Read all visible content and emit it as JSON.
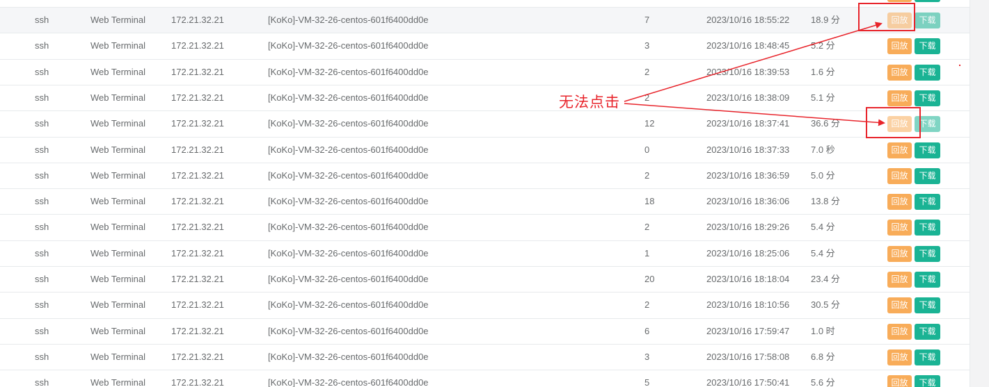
{
  "buttons": {
    "replay_label": "回放",
    "download_label": "下载"
  },
  "annotation": {
    "text": "无法点击",
    "color": "#e8242b"
  },
  "colors": {
    "replay": "#f8ac59",
    "download": "#1ab394",
    "text": "#676a6c",
    "border": "#e7eaec"
  },
  "sessions": [
    {
      "protocol": "ssh",
      "login_from": "Web Terminal",
      "remote_addr": "172.21.32.21",
      "asset": "[KoKo]-VM-32-26-centos-601f6400dd0e",
      "commands": "7",
      "date_start": "2023/10/16 18:55:22",
      "duration": "18.9 分",
      "disabled": true,
      "hover": true
    },
    {
      "protocol": "ssh",
      "login_from": "Web Terminal",
      "remote_addr": "172.21.32.21",
      "asset": "[KoKo]-VM-32-26-centos-601f6400dd0e",
      "commands": "3",
      "date_start": "2023/10/16 18:48:45",
      "duration": "5.2 分",
      "disabled": false
    },
    {
      "protocol": "ssh",
      "login_from": "Web Terminal",
      "remote_addr": "172.21.32.21",
      "asset": "[KoKo]-VM-32-26-centos-601f6400dd0e",
      "commands": "2",
      "date_start": "2023/10/16 18:39:53",
      "duration": "1.6 分",
      "disabled": false
    },
    {
      "protocol": "ssh",
      "login_from": "Web Terminal",
      "remote_addr": "172.21.32.21",
      "asset": "[KoKo]-VM-32-26-centos-601f6400dd0e",
      "commands": "2",
      "date_start": "2023/10/16 18:38:09",
      "duration": "5.1 分",
      "disabled": false
    },
    {
      "protocol": "ssh",
      "login_from": "Web Terminal",
      "remote_addr": "172.21.32.21",
      "asset": "[KoKo]-VM-32-26-centos-601f6400dd0e",
      "commands": "12",
      "date_start": "2023/10/16 18:37:41",
      "duration": "36.6 分",
      "disabled": true
    },
    {
      "protocol": "ssh",
      "login_from": "Web Terminal",
      "remote_addr": "172.21.32.21",
      "asset": "[KoKo]-VM-32-26-centos-601f6400dd0e",
      "commands": "0",
      "date_start": "2023/10/16 18:37:33",
      "duration": "7.0 秒",
      "disabled": false
    },
    {
      "protocol": "ssh",
      "login_from": "Web Terminal",
      "remote_addr": "172.21.32.21",
      "asset": "[KoKo]-VM-32-26-centos-601f6400dd0e",
      "commands": "2",
      "date_start": "2023/10/16 18:36:59",
      "duration": "5.0 分",
      "disabled": false
    },
    {
      "protocol": "ssh",
      "login_from": "Web Terminal",
      "remote_addr": "172.21.32.21",
      "asset": "[KoKo]-VM-32-26-centos-601f6400dd0e",
      "commands": "18",
      "date_start": "2023/10/16 18:36:06",
      "duration": "13.8 分",
      "disabled": false
    },
    {
      "protocol": "ssh",
      "login_from": "Web Terminal",
      "remote_addr": "172.21.32.21",
      "asset": "[KoKo]-VM-32-26-centos-601f6400dd0e",
      "commands": "2",
      "date_start": "2023/10/16 18:29:26",
      "duration": "5.4 分",
      "disabled": false
    },
    {
      "protocol": "ssh",
      "login_from": "Web Terminal",
      "remote_addr": "172.21.32.21",
      "asset": "[KoKo]-VM-32-26-centos-601f6400dd0e",
      "commands": "1",
      "date_start": "2023/10/16 18:25:06",
      "duration": "5.4 分",
      "disabled": false
    },
    {
      "protocol": "ssh",
      "login_from": "Web Terminal",
      "remote_addr": "172.21.32.21",
      "asset": "[KoKo]-VM-32-26-centos-601f6400dd0e",
      "commands": "20",
      "date_start": "2023/10/16 18:18:04",
      "duration": "23.4 分",
      "disabled": false
    },
    {
      "protocol": "ssh",
      "login_from": "Web Terminal",
      "remote_addr": "172.21.32.21",
      "asset": "[KoKo]-VM-32-26-centos-601f6400dd0e",
      "commands": "2",
      "date_start": "2023/10/16 18:10:56",
      "duration": "30.5 分",
      "disabled": false
    },
    {
      "protocol": "ssh",
      "login_from": "Web Terminal",
      "remote_addr": "172.21.32.21",
      "asset": "[KoKo]-VM-32-26-centos-601f6400dd0e",
      "commands": "6",
      "date_start": "2023/10/16 17:59:47",
      "duration": "1.0 时",
      "disabled": false
    },
    {
      "protocol": "ssh",
      "login_from": "Web Terminal",
      "remote_addr": "172.21.32.21",
      "asset": "[KoKo]-VM-32-26-centos-601f6400dd0e",
      "commands": "3",
      "date_start": "2023/10/16 17:58:08",
      "duration": "6.8 分",
      "disabled": false
    },
    {
      "protocol": "ssh",
      "login_from": "Web Terminal",
      "remote_addr": "172.21.32.21",
      "asset": "[KoKo]-VM-32-26-centos-601f6400dd0e",
      "commands": "5",
      "date_start": "2023/10/16 17:50:41",
      "duration": "5.6 分",
      "disabled": false
    }
  ]
}
